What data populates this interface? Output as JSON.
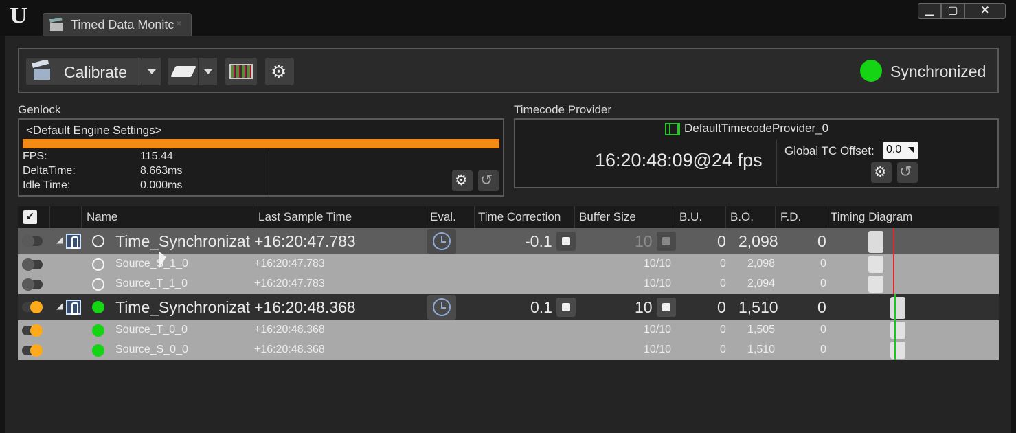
{
  "window": {
    "logo": "U",
    "tab_label": "Timed Data Monitc",
    "tab_close": "×",
    "buttons": {
      "minimize": "▁",
      "maximize": "▢",
      "close": "✕"
    }
  },
  "toolbar": {
    "calibrate_label": "Calibrate",
    "status_label": "Synchronized",
    "status_color": "#14d414"
  },
  "genlock": {
    "section_title": "Genlock",
    "name": "<Default Engine Settings>",
    "bar_color": "#f28a14",
    "stats": [
      {
        "label": "FPS:",
        "value": "115.44"
      },
      {
        "label": "DeltaTime:",
        "value": "8.663ms"
      },
      {
        "label": "Idle Time:",
        "value": "0.000ms"
      }
    ]
  },
  "timecode": {
    "section_title": "Timecode Provider",
    "provider_name": "DefaultTimecodeProvider_0",
    "time": "16:20:48:09@24 fps",
    "offset_label": "Global TC Offset:",
    "offset_value": "0.0"
  },
  "table": {
    "headers": [
      "Name",
      "Last Sample Time",
      "Eval.",
      "Time Correction",
      "Buffer Size",
      "B.U.",
      "B.O.",
      "F.D.",
      "Timing Diagram"
    ],
    "groups": [
      {
        "name": "Time_Synchronizat",
        "last_sample": "+16:20:47.783",
        "time_correction": "-0.1",
        "buffer_size": "10",
        "bu": "0",
        "bo": "2,098",
        "fd": "0",
        "enabled": false,
        "children": [
          {
            "name": "Source_S_1_0",
            "last_sample": "+16:20:47.783",
            "buffer": "10/10",
            "bu": "0",
            "bo": "2,098",
            "fd": "0"
          },
          {
            "name": "Source_T_1_0",
            "last_sample": "+16:20:47.783",
            "buffer": "10/10",
            "bu": "0",
            "bo": "2,094",
            "fd": "0"
          }
        ]
      },
      {
        "name": "Time_Synchronizat",
        "last_sample": "+16:20:48.368",
        "time_correction": "0.1",
        "buffer_size": "10",
        "bu": "0",
        "bo": "1,510",
        "fd": "0",
        "enabled": true,
        "children": [
          {
            "name": "Source_T_0_0",
            "last_sample": "+16:20:48.368",
            "buffer": "10/10",
            "bu": "0",
            "bo": "1,505",
            "fd": "0"
          },
          {
            "name": "Source_S_0_0",
            "last_sample": "+16:20:48.368",
            "buffer": "10/10",
            "bu": "0",
            "bo": "1,510",
            "fd": "0"
          }
        ]
      }
    ]
  },
  "icons": [
    "calibrate-clapper-icon",
    "eraser-icon",
    "timecode-grid-icon",
    "gear-icon",
    "reset-icon",
    "film-icon",
    "clock-icon",
    "edit-icon",
    "person-icon"
  ]
}
